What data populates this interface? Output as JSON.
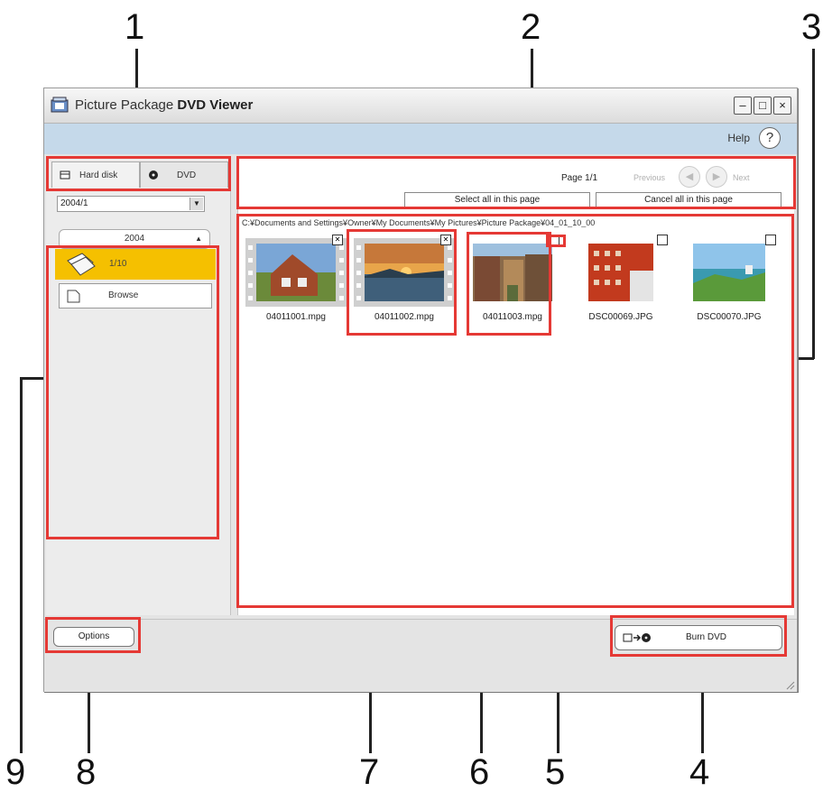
{
  "callouts": [
    "1",
    "2",
    "3",
    "4",
    "5",
    "6",
    "7",
    "8",
    "9"
  ],
  "window": {
    "title_prefix": "Picture Package",
    "title_bold": "DVD Viewer",
    "controls": {
      "minimize": "–",
      "maximize": "□",
      "close": "×"
    }
  },
  "helpbar": {
    "label": "Help",
    "icon": "?"
  },
  "tabs": [
    {
      "label": "Hard disk",
      "icon": "hard-disk-icon"
    },
    {
      "label": "DVD",
      "icon": "dvd-disc-icon"
    }
  ],
  "month_select": {
    "value": "2004/1"
  },
  "year_button": {
    "label": "2004"
  },
  "folder_items": [
    {
      "label": "1/10",
      "selected": true
    },
    {
      "label": "Browse",
      "selected": false
    }
  ],
  "pager": {
    "page_label": "Page 1/1",
    "previous_label": "Previous",
    "next_label": "Next",
    "select_all_label": "Select all in this page",
    "cancel_all_label": "Cancel all in this page"
  },
  "path": "C:¥Documents and Settings¥Owner¥My Documents¥My Pictures¥Picture Package¥04_01_10_00",
  "thumbnails": [
    {
      "filename": "04011001.mpg",
      "type": "movie",
      "checked": true
    },
    {
      "filename": "04011002.mpg",
      "type": "movie",
      "checked": true
    },
    {
      "filename": "04011003.mpg",
      "type": "movie",
      "checked": false
    },
    {
      "filename": "DSC00069.JPG",
      "type": "photo",
      "checked": false
    },
    {
      "filename": "DSC00070.JPG",
      "type": "photo",
      "checked": false
    }
  ],
  "bottom": {
    "options_label": "Options",
    "burn_label": "Burn DVD"
  },
  "colors": {
    "highlight": "#e53935",
    "selected_item": "#f5c000",
    "helpbar": "#c5d9ea"
  }
}
